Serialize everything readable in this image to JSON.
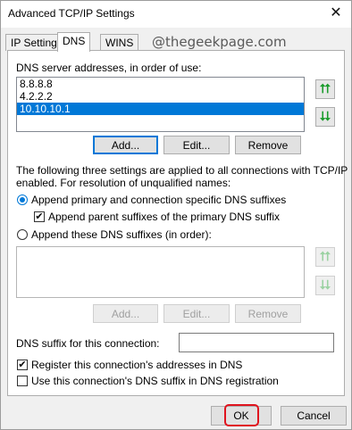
{
  "window": {
    "title": "Advanced TCP/IP Settings",
    "close_glyph": "✕"
  },
  "tabs": [
    {
      "label": "IP Settings",
      "active": false
    },
    {
      "label": "DNS",
      "active": true
    },
    {
      "label": "WINS",
      "active": false
    }
  ],
  "watermark": "@thegeekpage.com",
  "dns": {
    "servers_label": "DNS server addresses, in order of use:",
    "servers": [
      "8.8.8.8",
      "4.2.2.2",
      "10.10.10.1"
    ],
    "selected_server": "10.10.10.1",
    "add_label": "Add...",
    "edit_label": "Edit...",
    "remove_label": "Remove",
    "up_arrow": "⮅",
    "down_arrow": "⮇",
    "info_text_line1": "The following three settings are applied to all connections with TCP/IP",
    "info_text_line2": "enabled. For resolution of unqualified names:",
    "append_primary_label": "Append primary and connection specific DNS suffixes",
    "append_primary_selected": true,
    "append_parent_label": "Append parent suffixes of the primary DNS suffix",
    "append_parent_checked": true,
    "append_these_label": "Append these DNS suffixes (in order):",
    "append_these_selected": false,
    "suffix_add_label": "Add...",
    "suffix_edit_label": "Edit...",
    "suffix_remove_label": "Remove",
    "suffix_conn_label": "DNS suffix for this connection:",
    "suffix_conn_value": "",
    "register_label": "Register this connection's addresses in DNS",
    "register_checked": true,
    "use_suffix_label": "Use this connection's DNS suffix in DNS registration",
    "use_suffix_checked": false,
    "check_glyph": "✔"
  },
  "footer": {
    "ok_label": "OK",
    "cancel_label": "Cancel"
  },
  "colors": {
    "selection": "#0078d7",
    "highlight_box": "#e0141e",
    "arrow_green": "#1a9c2c"
  }
}
